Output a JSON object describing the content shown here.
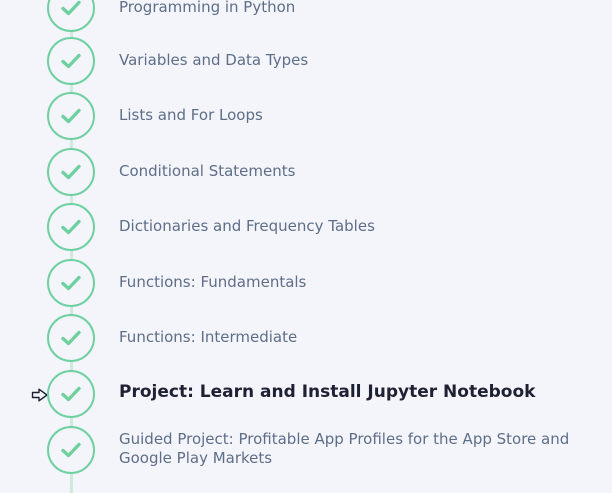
{
  "lessons": [
    {
      "label": "Programming in Python",
      "status": "completed",
      "icon": "check-icon"
    },
    {
      "label": "Variables and Data Types",
      "status": "completed",
      "icon": "check-icon"
    },
    {
      "label": "Lists and For Loops",
      "status": "completed",
      "icon": "check-icon"
    },
    {
      "label": "Conditional Statements",
      "status": "completed",
      "icon": "check-icon"
    },
    {
      "label": "Dictionaries and Frequency Tables",
      "status": "completed",
      "icon": "check-icon"
    },
    {
      "label": "Functions: Fundamentals",
      "status": "completed",
      "icon": "check-icon"
    },
    {
      "label": "Functions: Intermediate",
      "status": "completed",
      "icon": "check-icon"
    },
    {
      "label": "Project: Learn and Install Jupyter Notebook",
      "status": "completed",
      "current": true,
      "icon": "check-icon"
    },
    {
      "label": "Guided Project: Profitable App Profiles for the App Store and Google Play Markets",
      "status": "completed",
      "icon": "check-icon"
    }
  ],
  "colors": {
    "background": "#f4f5fa",
    "check_green": "#6fd0a0",
    "connector": "#cfe9dc",
    "label": "#5e6e88",
    "label_current": "#1e2033"
  },
  "current_marker_icon": "pointer-arrow-icon"
}
